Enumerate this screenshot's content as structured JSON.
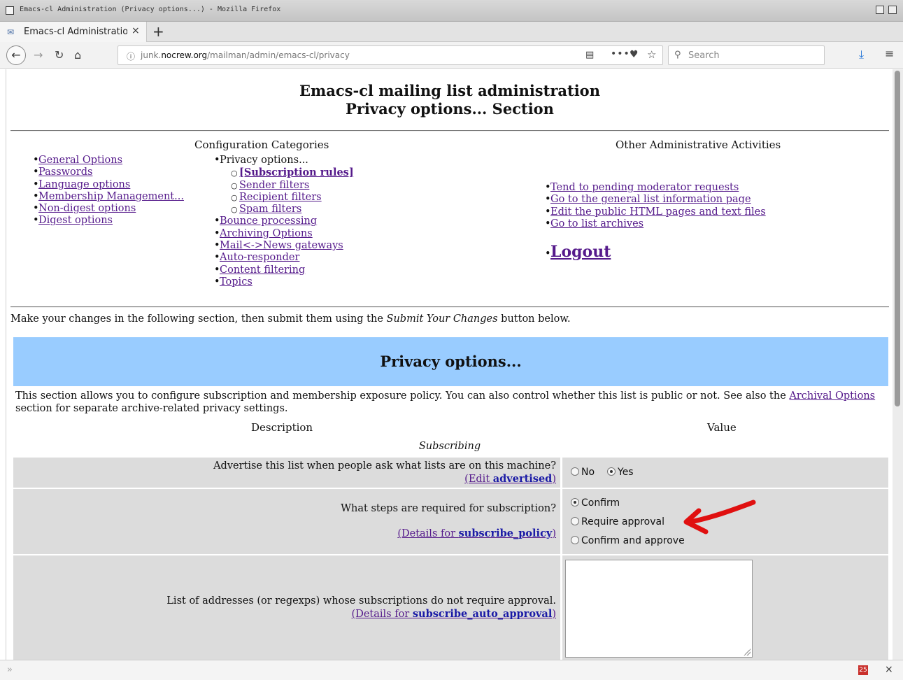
{
  "window": {
    "title": "Emacs-cl Administration (Privacy options...) - Mozilla Firefox"
  },
  "tab": {
    "title": "Emacs-cl Administration |",
    "close": "×",
    "new_tab": "+"
  },
  "nav": {
    "url_prefix": "junk.",
    "url_domain": "nocrew.org",
    "url_path": "/mailman/admin/emacs-cl/privacy",
    "search_placeholder": "Search"
  },
  "page": {
    "title_line1": "Emacs-cl mailing list administration",
    "title_line2": "Privacy options... Section",
    "config_heading": "Configuration Categories",
    "other_heading": "Other Administrative Activities",
    "categories_left": [
      "General Options",
      "Passwords",
      "Language options",
      "Membership Management...",
      "Non-digest options",
      "Digest options"
    ],
    "categories_right_current": "Privacy options...",
    "categories_right_sub": [
      "[Subscription rules]",
      "Sender filters",
      "Recipient filters",
      "Spam filters"
    ],
    "categories_right_rest": [
      "Bounce processing",
      "Archiving Options",
      "Mail<->News gateways",
      "Auto-responder",
      "Content filtering",
      "Topics"
    ],
    "other_links": [
      "Tend to pending moderator requests",
      "Go to the general list information page",
      "Edit the public HTML pages and text files",
      "Go to list archives"
    ],
    "logout": "Logout",
    "intro_before": "Make your changes in the following section, then submit them using the ",
    "intro_em": "Submit Your Changes",
    "intro_after": " button below.",
    "section_banner": "Privacy options...",
    "section_desc_1": "This section allows you to configure subscription and membership exposure policy. You can also control whether this list is public or not. See also the ",
    "section_desc_link": "Archival Options",
    "section_desc_2": " section for separate archive-related privacy settings.",
    "col_description": "Description",
    "col_value": "Value",
    "subsection": "Subscribing",
    "settings": [
      {
        "question": "Advertise this list when people ask what lists are on this machine?",
        "details_prefix": "(Edit ",
        "details_name": "advertised",
        "details_suffix": ")",
        "options": [
          "No",
          "Yes"
        ],
        "selected": "Yes"
      },
      {
        "question": "What steps are required for subscription?",
        "details_prefix": "(Details for ",
        "details_name": "subscribe_policy",
        "details_suffix": ")",
        "options": [
          "Confirm",
          "Require approval",
          "Confirm and approve"
        ],
        "selected": "Confirm"
      },
      {
        "question": "List of addresses (or regexps) whose subscriptions do not require approval.",
        "details_prefix": "(Details for ",
        "details_name": "subscribe_auto_approval",
        "details_suffix": ")",
        "value": ""
      }
    ]
  },
  "status": {
    "badge": "25",
    "close": "×"
  },
  "colors": {
    "banner": "#99ccff",
    "row": "#dcdcdc",
    "visited_link": "#551a8b",
    "annotation_arrow": "#e01010"
  }
}
